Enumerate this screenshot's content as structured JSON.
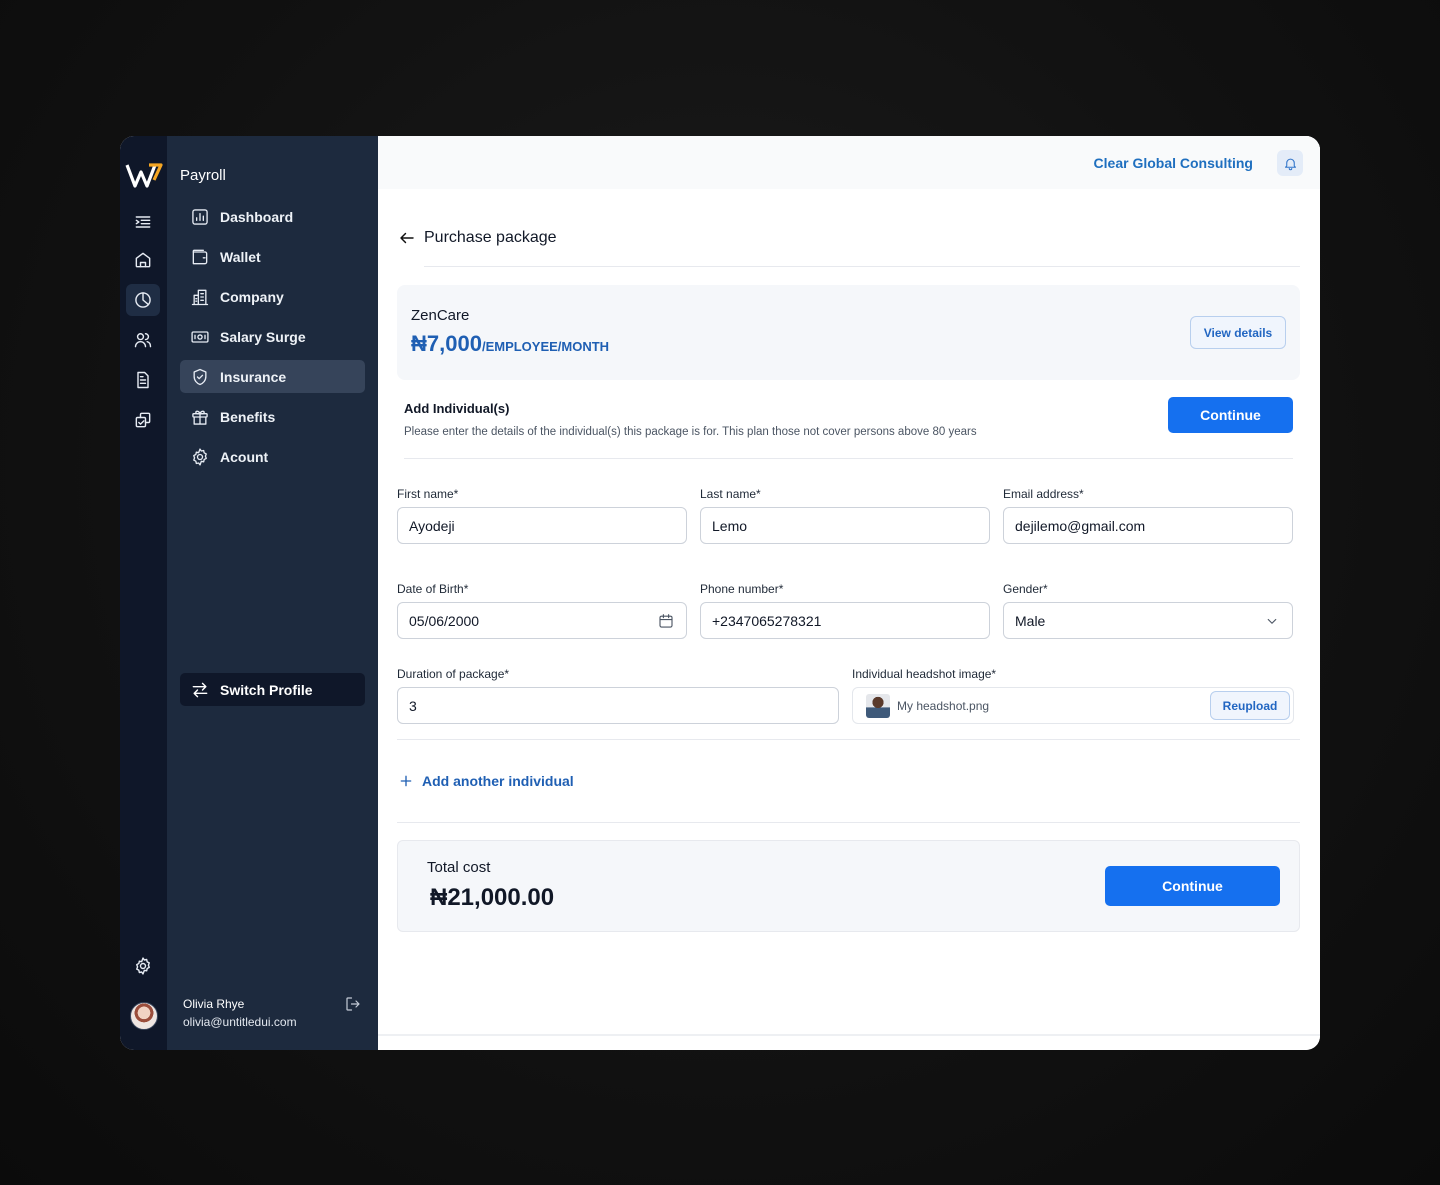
{
  "sidebar": {
    "app_title": "Payroll",
    "nav": [
      {
        "label": "Dashboard",
        "icon": "bar-chart-icon"
      },
      {
        "label": "Wallet",
        "icon": "wallet-icon"
      },
      {
        "label": "Company",
        "icon": "building-icon"
      },
      {
        "label": "Salary Surge",
        "icon": "banknote-icon"
      },
      {
        "label": "Insurance",
        "icon": "shield-check-icon",
        "active": true
      },
      {
        "label": "Benefits",
        "icon": "gift-icon"
      },
      {
        "label": "Acount",
        "icon": "gear-icon"
      }
    ],
    "switch_profile": "Switch Profile",
    "user": {
      "name": "Olivia Rhye",
      "email": "olivia@untitledui.com"
    }
  },
  "rail": {
    "icons": [
      "menu-icon",
      "home-icon",
      "pie-chart-icon",
      "users-icon",
      "document-icon",
      "copy-icon",
      "gear-icon"
    ],
    "active": "pie-chart-icon"
  },
  "header": {
    "org_name": "Clear Global Consulting"
  },
  "page": {
    "title": "Purchase package"
  },
  "package": {
    "name": "ZenCare",
    "price": "₦7,000",
    "unit": "/EMPLOYEE/MONTH",
    "view_details": "View details"
  },
  "individual_section": {
    "heading": "Add Individual(s)",
    "description": "Please enter the details of the individual(s) this package is for. This plan those not cover persons above 80 years",
    "continue": "Continue"
  },
  "form": {
    "first_name": {
      "label": "First name*",
      "value": "Ayodeji"
    },
    "last_name": {
      "label": "Last name*",
      "value": "Lemo"
    },
    "email": {
      "label": "Email address*",
      "value": "dejilemo@gmail.com"
    },
    "dob": {
      "label": "Date of Birth*",
      "value": "05/06/2000"
    },
    "phone": {
      "label": "Phone number*",
      "value": "+2347065278321"
    },
    "gender": {
      "label": "Gender*",
      "value": "Male"
    },
    "duration": {
      "label": "Duration of package*",
      "value": "3"
    },
    "headshot": {
      "label": "Individual headshot image*",
      "file_name": "My headshot.png",
      "reupload": "Reupload"
    }
  },
  "add_another": "Add another individual",
  "total": {
    "label": "Total cost",
    "value": "₦21,000.00",
    "continue": "Continue"
  },
  "colors": {
    "primary": "#1570ef",
    "sidebar": "#1d2a3e",
    "rail": "#0f1729",
    "link": "#1f5fb3"
  }
}
